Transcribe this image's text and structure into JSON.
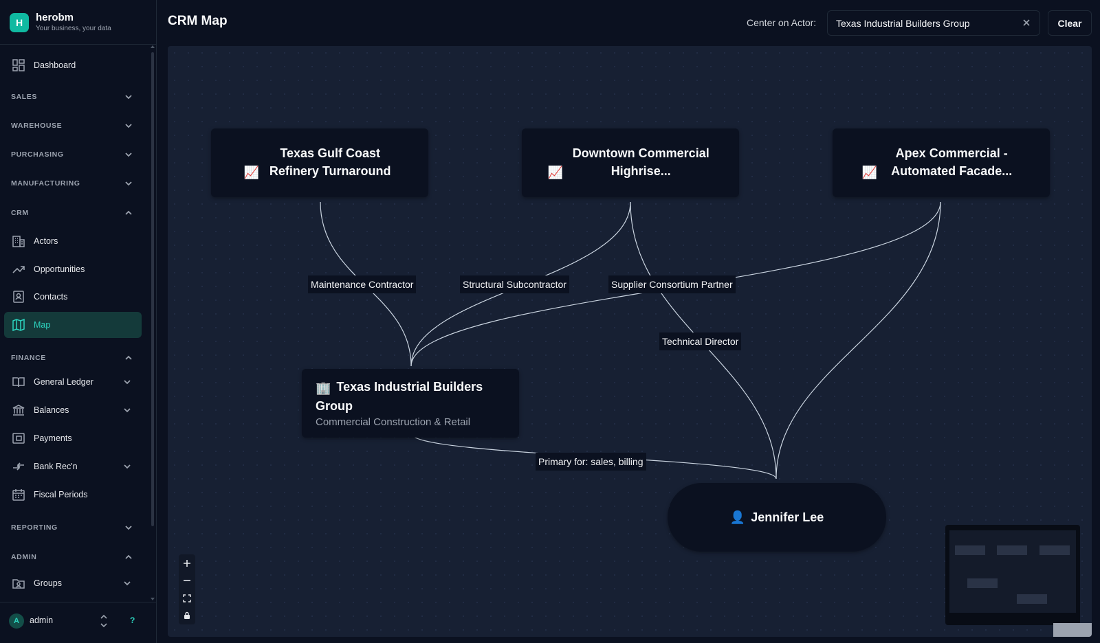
{
  "brand": {
    "logo_letter": "H",
    "name": "herobm",
    "tagline": "Your business, your data"
  },
  "sidebar": {
    "dashboard": "Dashboard",
    "sections": {
      "sales": "SALES",
      "warehouse": "WAREHOUSE",
      "purchasing": "PURCHASING",
      "manufacturing": "MANUFACTURING",
      "crm": "CRM",
      "finance": "FINANCE",
      "reporting": "REPORTING",
      "admin": "ADMIN"
    },
    "crm_items": {
      "actors": "Actors",
      "opportunities": "Opportunities",
      "contacts": "Contacts",
      "map": "Map"
    },
    "finance_items": {
      "general_ledger": "General Ledger",
      "balances": "Balances",
      "payments": "Payments",
      "bank_rec": "Bank Rec'n",
      "fiscal_periods": "Fiscal Periods"
    },
    "admin_items": {
      "groups": "Groups"
    },
    "active_item": "Map",
    "accent_color": "#2dd4bf"
  },
  "user": {
    "avatar_letter": "A",
    "name": "admin",
    "help": "?"
  },
  "header": {
    "title": "CRM Map",
    "center_label": "Center on Actor:",
    "center_value": "Texas Industrial Builders Group",
    "clear_label": "Clear"
  },
  "map": {
    "opportunities": [
      {
        "icon": "📈",
        "title": "Texas Gulf Coast Refinery Turnaround"
      },
      {
        "icon": "📈",
        "title": "Downtown Commercial Highrise..."
      },
      {
        "icon": "📈",
        "title": "Apex Commercial - Automated Facade..."
      }
    ],
    "actor": {
      "icon": "🏢",
      "title": "Texas Industrial Builders Group",
      "subtitle": "Commercial Construction & Retail"
    },
    "person": {
      "icon": "👤",
      "name": "Jennifer Lee"
    },
    "edge_labels": {
      "maintenance": "Maintenance Contractor",
      "structural": "Structural Subcontractor",
      "supplier": "Supplier Consortium Partner",
      "technical": "Technical Director",
      "primary": "Primary for: sales, billing"
    }
  }
}
